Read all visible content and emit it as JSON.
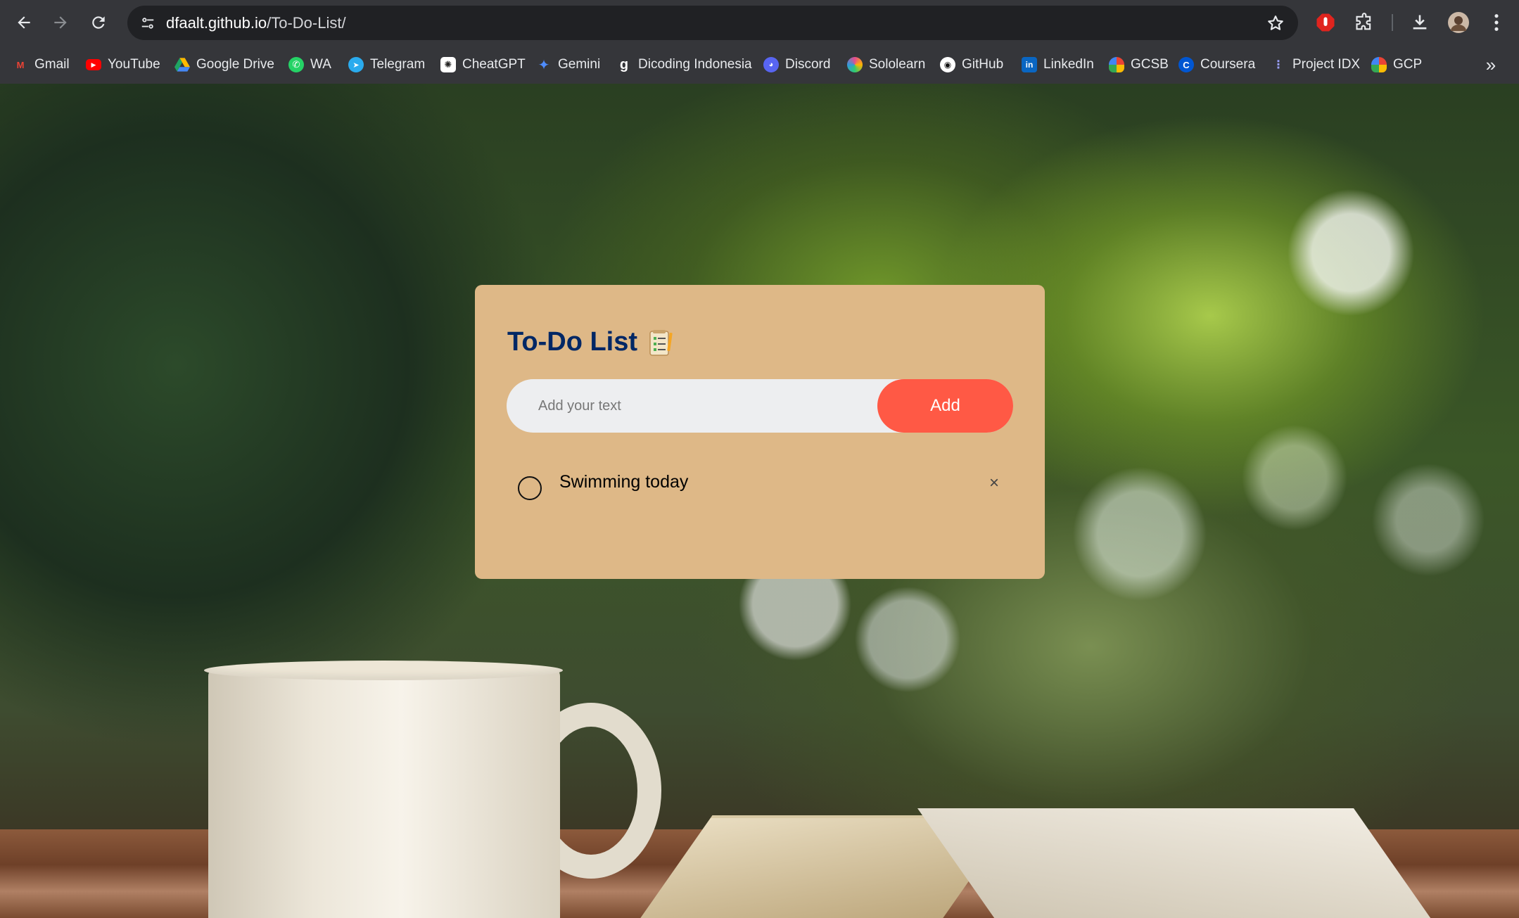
{
  "browser": {
    "url_host": "dfaalt.github.io",
    "url_path": "/To-Do-List/",
    "bookmarks": [
      {
        "label": "Gmail",
        "icon": "gmail-icon",
        "color": "#ea4335"
      },
      {
        "label": "YouTube",
        "icon": "youtube-icon",
        "color": "#ff0000"
      },
      {
        "label": "Google Drive",
        "icon": "google-drive-icon",
        "color": "#1fa463"
      },
      {
        "label": "WA",
        "icon": "whatsapp-icon",
        "color": "#25d366"
      },
      {
        "label": "Telegram",
        "icon": "telegram-icon",
        "color": "#2aabee"
      },
      {
        "label": "CheatGPT",
        "icon": "chatgpt-icon",
        "color": "#ffffff"
      },
      {
        "label": "Gemini",
        "icon": "gemini-icon",
        "color": "#4e8cff"
      },
      {
        "label": "Dicoding Indonesia",
        "icon": "dicoding-icon",
        "color": "#ffffff"
      },
      {
        "label": "Discord",
        "icon": "discord-icon",
        "color": "#5865f2"
      },
      {
        "label": "Sololearn",
        "icon": "sololearn-icon",
        "color": "#e64c8e"
      },
      {
        "label": "GitHub",
        "icon": "github-icon",
        "color": "#ffffff"
      },
      {
        "label": "LinkedIn",
        "icon": "linkedin-icon",
        "color": "#0a66c2"
      },
      {
        "label": "GCSB",
        "icon": "google-cloud-icon",
        "color": "#fbbc04"
      },
      {
        "label": "Coursera",
        "icon": "coursera-icon",
        "color": "#0056d2"
      },
      {
        "label": "Project IDX",
        "icon": "project-idx-icon",
        "color": "#9aa0ff"
      },
      {
        "label": "GCP",
        "icon": "google-cloud-icon",
        "color": "#fbbc04"
      }
    ]
  },
  "app": {
    "title": "To-Do List",
    "title_icon": "checklist-notepad-icon",
    "input_placeholder": "Add your text",
    "input_value": "",
    "add_label": "Add",
    "tasks": [
      {
        "text": "Swimming today",
        "checked": false,
        "remove_symbol": "×"
      }
    ]
  },
  "colors": {
    "card_bg": "#deb887",
    "title": "#002765",
    "add_button": "#ff5945",
    "input_bg": "#edeef0"
  }
}
